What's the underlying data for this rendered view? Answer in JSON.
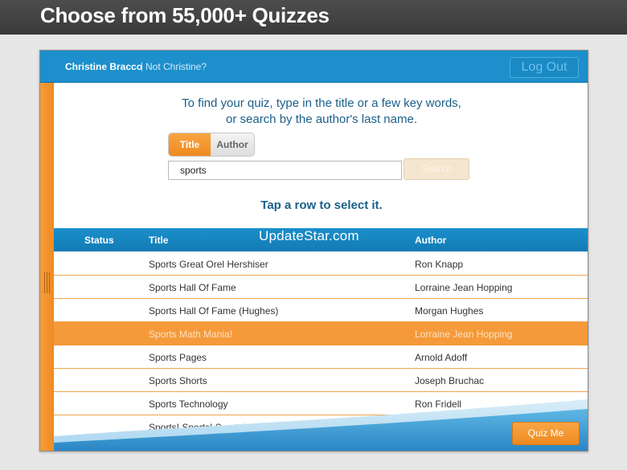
{
  "banner": {
    "title": "Choose from 55,000+ Quizzes"
  },
  "header": {
    "user_name": "Christine Bracco",
    "separator": "|",
    "not_user": "Not Christine?",
    "logout_label": "Log Out"
  },
  "search": {
    "instructions_line1": "To find your quiz, type in the title or a few key words,",
    "instructions_line2": "or search by the author's last name.",
    "mode_title": "Title",
    "mode_author": "Author",
    "selected_mode": "Title",
    "query": "sports",
    "search_label": "Search"
  },
  "results": {
    "prompt": "Tap a row to select it.",
    "columns": {
      "status": "Status",
      "title": "Title",
      "author": "Author"
    },
    "watermark": "UpdateStar.com",
    "rows": [
      {
        "title": "Sports Great Orel Hershiser",
        "author": "Ron Knapp"
      },
      {
        "title": "Sports Hall Of Fame",
        "author": "Lorraine Jean Hopping"
      },
      {
        "title": "Sports Hall Of Fame (Hughes)",
        "author": "Morgan Hughes"
      },
      {
        "title": "Sports Math Mania!",
        "author": "Lorraine Jean Hopping"
      },
      {
        "title": "Sports Pages",
        "author": "Arnold Adoff"
      },
      {
        "title": "Sports Shorts",
        "author": "Joseph Bruchac"
      },
      {
        "title": "Sports Technology",
        "author": "Ron Fridell"
      },
      {
        "title": "Sports! Sports! Sports!",
        "author": ""
      }
    ],
    "selected_row": "Sports Math Mania!"
  },
  "footer": {
    "quiz_me_label": "Quiz Me"
  },
  "colors": {
    "accent_orange": "#f59a3a",
    "header_blue": "#1c8fcc",
    "text_blue": "#1a5f8a"
  }
}
